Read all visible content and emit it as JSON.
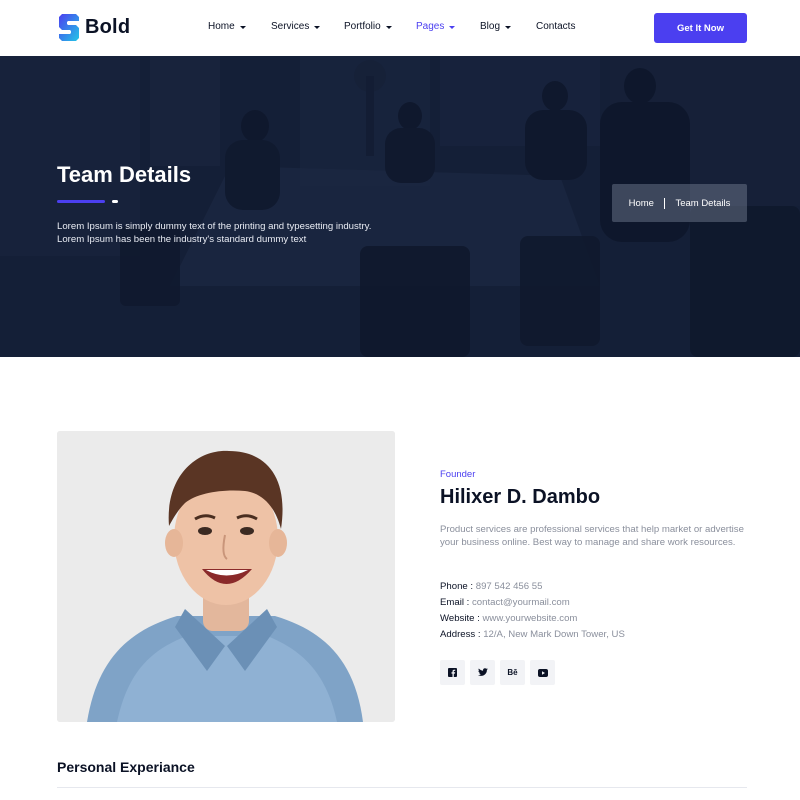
{
  "brand": {
    "name": "Bold",
    "accent": "#4b3ff0",
    "dark": "#0b1225",
    "muted": "#8a8f9c"
  },
  "nav": {
    "items": [
      {
        "label": "Home",
        "has_dropdown": true,
        "active": false
      },
      {
        "label": "Services",
        "has_dropdown": true,
        "active": false
      },
      {
        "label": "Portfolio",
        "has_dropdown": true,
        "active": false
      },
      {
        "label": "Pages",
        "has_dropdown": true,
        "active": true
      },
      {
        "label": "Blog",
        "has_dropdown": true,
        "active": false
      },
      {
        "label": "Contacts",
        "has_dropdown": false,
        "active": false
      }
    ],
    "cta_label": "Get It Now"
  },
  "hero": {
    "title": "Team Details",
    "text_line1": "Lorem Ipsum is simply dummy text of the printing and typesetting industry.",
    "text_line2": "Lorem Ipsum has been the industry's standard dummy text",
    "breadcrumb": {
      "home": "Home",
      "current": "Team Details"
    }
  },
  "profile": {
    "role": "Founder",
    "name": "Hilixer D. Dambo",
    "bio": "Product services are professional services that help market or advertise your business online. Best way to manage and share work resources.",
    "contact": {
      "phone_label": "Phone :",
      "phone": "897 542 456 55",
      "email_label": "Email :",
      "email": "contact@yourmail.com",
      "website_label": "Website :",
      "website": "www.yourwebsite.com",
      "address_label": "Address :",
      "address": "12/A, New Mark Down Tower, US"
    },
    "social": [
      {
        "icon": "facebook-icon",
        "glyph": "f"
      },
      {
        "icon": "twitter-icon",
        "glyph": "t"
      },
      {
        "icon": "behance-icon",
        "glyph": "Bē"
      },
      {
        "icon": "youtube-icon",
        "glyph": "▶"
      }
    ]
  },
  "section": {
    "title": "Personal Experiance"
  }
}
